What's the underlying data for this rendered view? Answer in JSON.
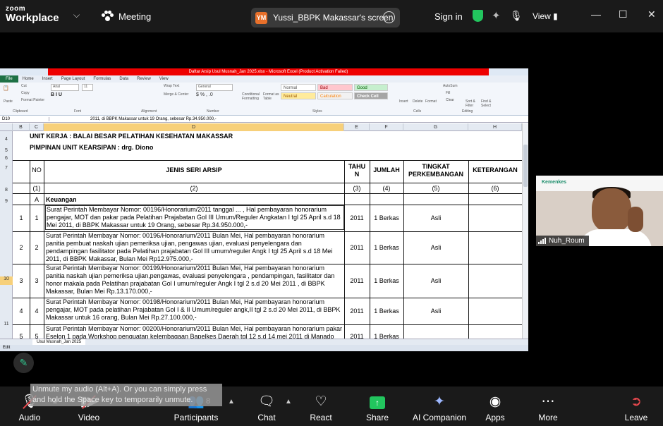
{
  "zoom": {
    "brand_top": "zoom",
    "brand_bottom": "Workplace",
    "meeting_label": "Meeting",
    "share_initials": "YM",
    "share_title": "Yussi_BBPK Makassar's screen",
    "sign_in": "Sign in",
    "view_label": "View",
    "colors": {
      "accent_green": "#22c55e",
      "share_avatar": "#e8702a",
      "end_red": "#e5484d"
    }
  },
  "excel": {
    "window_title": "Daftar Arsip Usul Musnah_Jan 2025.xlsx - Microsoft Excel (Product Activation Failed)",
    "menu_tabs": [
      "File",
      "Home",
      "Insert",
      "Page Layout",
      "Formulas",
      "Data",
      "Review",
      "View"
    ],
    "ribbon": {
      "groups": [
        "Clipboard",
        "Font",
        "Alignment",
        "Number",
        "Styles",
        "Cells",
        "Editing"
      ],
      "clipboard_items": [
        "Cut",
        "Copy",
        "Format Painter",
        "Paste"
      ],
      "font_name": "Arial",
      "font_size": "11",
      "alignment_items": [
        "Wrap Text",
        "Merge & Center"
      ],
      "number_format": "General",
      "style_cells": [
        "Normal",
        "Bad",
        "Good",
        "Neutral",
        "Calculation",
        "Check Cell"
      ],
      "style_buttons": [
        "Conditional Formatting",
        "Format as Table"
      ],
      "cells_items": [
        "Insert",
        "Delete",
        "Format"
      ],
      "editing_items": [
        "AutoSum",
        "Fill",
        "Clear",
        "Sort & Filter",
        "Find & Select"
      ]
    },
    "name_box": "D10",
    "formula": "2011, di BBPK Makassar untuk 19 Orang, sebesar  Rp.34.950.000,-",
    "columns": [
      "B",
      "C",
      "D",
      "E",
      "F",
      "G",
      "H"
    ],
    "header_lines": [
      "UNIT KERJA : BALAI BESAR PELATIHAN KESEHATAN MAKASSAR",
      "PIMPINAN UNIT KEARSIPAN : drg. Diono"
    ],
    "table_headers": {
      "no": "NO",
      "jenis": "JENIS SERI ARSIP",
      "tahun": "TAHU N",
      "jumlah": "JUMLAH",
      "tingkat": "TINGKAT PERKEMBANGAN",
      "keterangan": "KETERANGAN"
    },
    "col_numbers": [
      "(1)",
      "(2)",
      "(3)",
      "(4)",
      "(5)",
      "(6)"
    ],
    "section_letter": "A",
    "section_title": "Keuangan",
    "rows": [
      {
        "b": "1",
        "c": "1",
        "text": "Surat Perintah Membayar Nomor:  00196/Honorarium/2011 tanggal ... ,  Hal pembayaran honorarium pengajar, MOT dan pakar pada Pelatihan Prajabatan Gol III Umum/Reguler Angkatan I tgl 25 April s.d 18 Mei 2011, di BBPK Makassar untuk 19 Orang, sebesar  Rp.34.950.000,-",
        "tahun": "2011",
        "jumlah": "1 Berkas",
        "tingkat": "Asli"
      },
      {
        "b": "2",
        "c": "2",
        "text": "Surat Perintah Membayar Nomor:  00196/Honorarium/2011  Bulan Mei,  Hal pembayaran honorarium panitia pembuat naskah ujian pemeriksa ujian, pengawas ujian, evaluasi penyelengara dan pendampingan fasilitator pada Pelatihan prajabatan Gol III umum/reguler Angk I tgl 25 April s.d 18 Mei 2011, di BBPK Makassar, Bulan Mei  Rp12.975.000,-",
        "tahun": "2011",
        "jumlah": "1 Berkas",
        "tingkat": "Asli"
      },
      {
        "b": "3",
        "c": "3",
        "text": "Surat Perintah Membayar Nomor:  00199/Honorarium/2011  Bulan Mei,  Hal pembayaran honorarium panitia  naskah ujian pemeriksa ujian,pengawas, evaluasi penyelengara , pendampingan, fasilitator dan honor makala pada Pelatihan prajabatan Gol I umum/reguler Angk I tgl 2 s.d 20 Mei 2011 , di BBPK Makassar, Bulan Mei  Rp.13.170.000,-",
        "tahun": "2011",
        "jumlah": "1 Berkas",
        "tingkat": "Asli"
      },
      {
        "b": "4",
        "c": "4",
        "text": "Surat Perintah Membayar Nomor:  00198/Honorarium/2011  Bulan Mei,  Hal pembayaran honorarium pengajar, MOT pada pelatihan Prajabatan Gol I & II Umum/reguler angk,II tgl 2 s.d 20 Mei 2011, di BBPK Makassar untuk 16 orang, Bulan Mei  Rp.27.100.000,-",
        "tahun": "2011",
        "jumlah": "1 Berkas",
        "tingkat": "Asli"
      },
      {
        "b": "5",
        "c": "5",
        "text": "Surat Perintah Membayar Nomor:  00200/Honorarium/2011  Bulan Mei,  Hal pembayaran honorarium pakar Eselon 1 pada Workshop penguatan kelembagaan Bapelkes Daerah tgl 12 s.d 14 mei 2011 di Manado",
        "tahun": "2011",
        "jumlah": "1 Berkas",
        "tingkat": ""
      }
    ],
    "sheet_tab": "Usul Musnah_Jan 2025",
    "status": "Edit"
  },
  "participant_video": {
    "org_logo": "Kemenkes",
    "name": "Nuh_Roum"
  },
  "tooltip": "Unmute my audio (Alt+A). Or you can simply press and hold the Space key to temporarily unmute.",
  "toolbar": {
    "audio": "Audio",
    "video": "Video",
    "participants": "Participants",
    "participants_count": "8",
    "chat": "Chat",
    "react": "React",
    "share": "Share",
    "ai_companion": "AI Companion",
    "apps": "Apps",
    "more": "More",
    "leave": "Leave"
  }
}
